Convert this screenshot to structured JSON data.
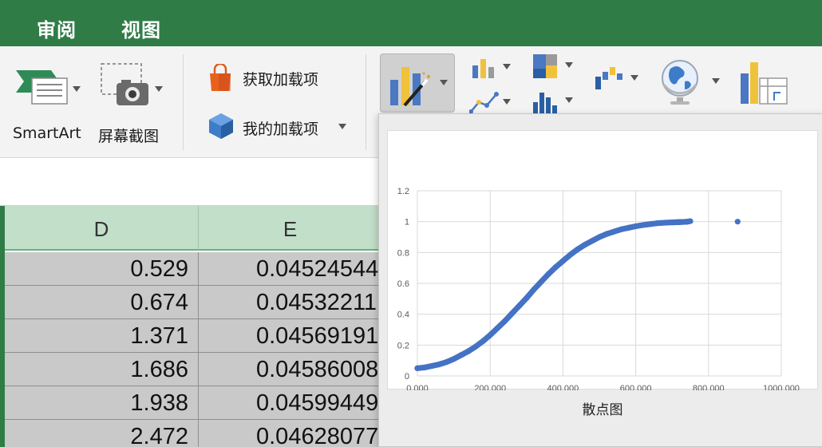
{
  "tabs": [
    "审阅",
    "视图"
  ],
  "ribbon": {
    "smartart_label": "SmartArt",
    "screenshot_label": "屏幕截图",
    "get_addins_label": "获取加载项",
    "my_addins_label": "我的加载项"
  },
  "sheet": {
    "columns": [
      "D",
      "E"
    ],
    "rows": [
      [
        "0.529",
        "0.04524544"
      ],
      [
        "0.674",
        "0.04532211"
      ],
      [
        "1.371",
        "0.04569191"
      ],
      [
        "1.686",
        "0.04586008"
      ],
      [
        "1.938",
        "0.04599449"
      ],
      [
        "2.472",
        "0.04628077"
      ]
    ]
  },
  "chart_popup": {
    "caption": "散点图"
  },
  "chart_data": {
    "type": "scatter",
    "title": "",
    "xlabel": "",
    "ylabel": "",
    "xlim": [
      0,
      1000
    ],
    "ylim": [
      0,
      1.2
    ],
    "x_ticks": [
      "0.000",
      "200.000",
      "400.000",
      "600.000",
      "800.000",
      "1000.000"
    ],
    "y_ticks": [
      "0",
      "0.2",
      "0.4",
      "0.6",
      "0.8",
      "1",
      "1.2"
    ],
    "grid": true,
    "color": "#4472c4",
    "x": [
      0,
      20,
      40,
      60,
      80,
      100,
      120,
      140,
      160,
      180,
      200,
      220,
      240,
      260,
      280,
      300,
      320,
      340,
      360,
      380,
      400,
      420,
      440,
      460,
      480,
      500,
      520,
      540,
      560,
      580,
      600,
      620,
      640,
      660,
      680,
      700,
      710,
      720,
      730,
      740,
      750,
      880
    ],
    "y": [
      0.05,
      0.055,
      0.065,
      0.075,
      0.09,
      0.11,
      0.135,
      0.16,
      0.19,
      0.225,
      0.265,
      0.31,
      0.355,
      0.405,
      0.455,
      0.505,
      0.56,
      0.61,
      0.66,
      0.705,
      0.745,
      0.785,
      0.82,
      0.85,
      0.875,
      0.9,
      0.92,
      0.935,
      0.95,
      0.96,
      0.97,
      0.978,
      0.984,
      0.99,
      0.993,
      0.995,
      0.996,
      0.997,
      0.998,
      0.999,
      1.003,
      1.0
    ]
  }
}
